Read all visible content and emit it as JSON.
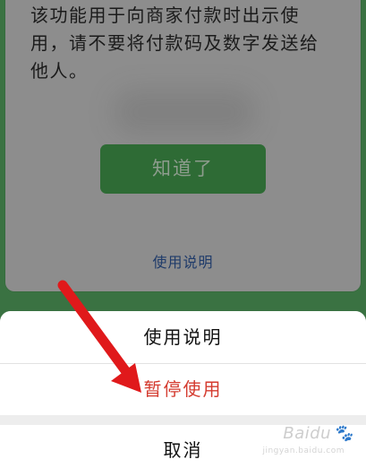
{
  "dialog": {
    "notice": "该功能用于向商家付款时出示使用，请不要将付款码及数字发送给他人。",
    "notice_lines": [
      "该功能用于向商家付款时出示使",
      "用，请不要将付款码及数字发送给",
      "他人。"
    ],
    "ok_label": "知道了",
    "usage_link": "使用说明"
  },
  "action_sheet": {
    "items": [
      {
        "label": "使用说明",
        "color": "#111111"
      },
      {
        "label": "暂停使用",
        "color": "#d43b2f"
      }
    ],
    "cancel_label": "取消"
  },
  "watermark": {
    "text": "Baidu",
    "sub": "jingyan.baidu.com",
    "icon": "paw-icon"
  },
  "colors": {
    "accent_green": "#2e6b35",
    "warning_red": "#d43b2f",
    "arrow_red": "#e0191b"
  }
}
